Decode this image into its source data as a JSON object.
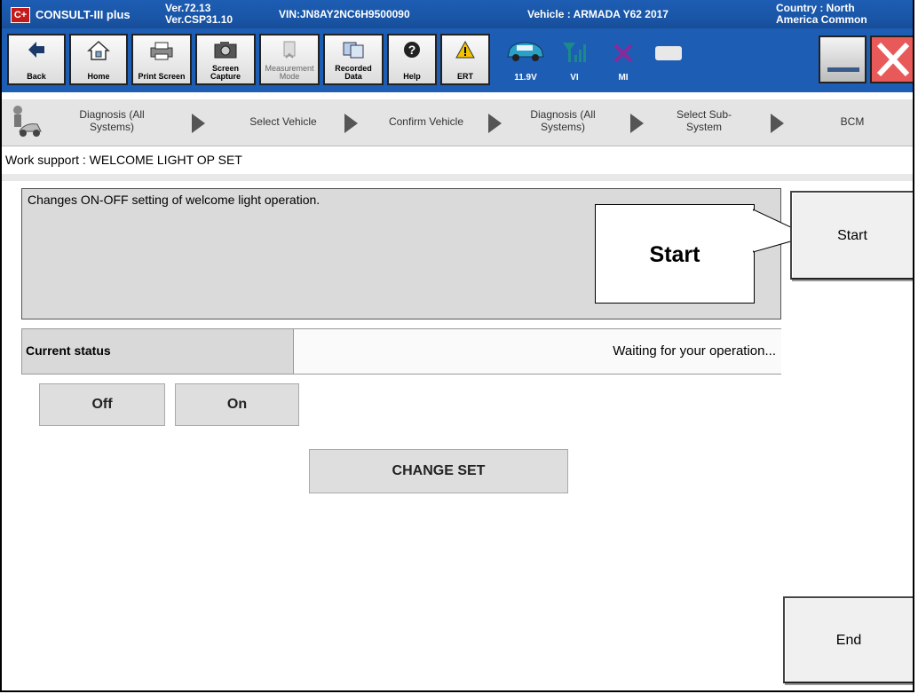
{
  "title": {
    "logo": "C+",
    "app": "CONSULT-III plus",
    "ver1": "Ver.72.13",
    "ver2": "Ver.CSP31.10",
    "vin": "VIN:JN8AY2NC6H9500090",
    "vehicle": "Vehicle : ARMADA Y62 2017",
    "country1": "Country : North",
    "country2": "America Common"
  },
  "toolbar": {
    "back": "Back",
    "home": "Home",
    "print": "Print Screen",
    "capture1": "Screen",
    "capture2": "Capture",
    "measure1": "Measurement",
    "measure2": "Mode",
    "recorded1": "Recorded",
    "recorded2": "Data",
    "help": "Help",
    "ert": "ERT",
    "voltage": "11.9V",
    "vi": "VI",
    "mi": "MI"
  },
  "breadcrumb": {
    "b1a": "Diagnosis (All",
    "b1b": "Systems)",
    "b2": "Select Vehicle",
    "b3": "Confirm Vehicle",
    "b4a": "Diagnosis (All",
    "b4b": "Systems)",
    "b5a": "Select Sub-",
    "b5b": "System",
    "b6": "BCM"
  },
  "work_support": {
    "title": "Work support : WELCOME LIGHT OP SET",
    "description": "Changes ON-OFF setting of welcome light operation.",
    "callout": "Start",
    "start": "Start",
    "status_label": "Current status",
    "status_value": "Waiting for your operation...",
    "off": "Off",
    "on": "On",
    "change_set": "CHANGE SET",
    "end": "End"
  },
  "colors": {
    "titlebar": "#1d5db3",
    "close": "#e85a5a",
    "vi_icon": "#1a8a8a",
    "mi_icon": "#8a2a9a"
  }
}
